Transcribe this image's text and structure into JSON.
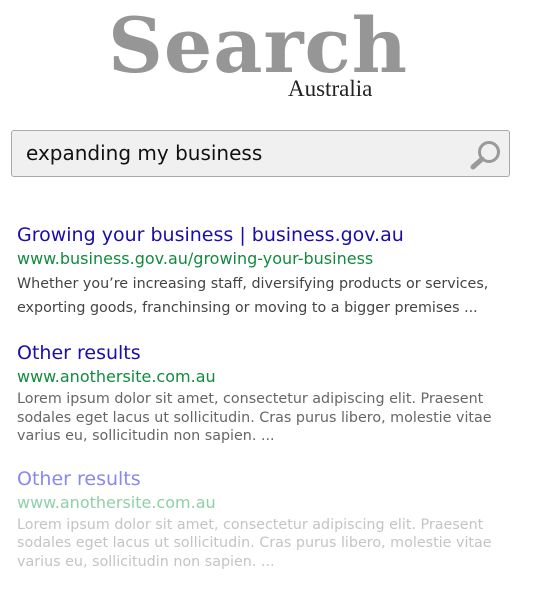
{
  "logo": {
    "main": "Search",
    "sub": "Australia"
  },
  "search": {
    "query": "expanding my business",
    "icon": "magnifier-icon"
  },
  "colors": {
    "title_blue": "#1a0dab",
    "url_green": "#128a3e",
    "snippet": "#444444",
    "faded_title": "#8888ee",
    "faded_url": "#8fd0a8",
    "faded_snippet": "#c4c4c4",
    "logo_gray": "#969696"
  },
  "results": [
    {
      "title": "Growing your business | business.gov.au",
      "url": "www.business.gov.au/growing-your-business",
      "snippet": "Whether you’re increasing staff, diversifying products or services, exporting goods, franchinsing or moving to a bigger premises ..."
    },
    {
      "title": "Other results",
      "url": "www.anothersite.com.au",
      "snippet": "Lorem ipsum dolor sit amet, consectetur adipiscing elit. Praesent sodales eget lacus ut sollicitudin. Cras purus libero, molestie vitae varius eu, sollicitudin non sapien. ..."
    },
    {
      "title": "Other results",
      "url": "www.anothersite.com.au",
      "snippet": "Lorem ipsum dolor sit amet, consectetur adipiscing elit. Praesent sodales eget lacus ut sollicitudin. Cras purus libero, molestie vitae varius eu, sollicitudin non sapien. ..."
    }
  ]
}
